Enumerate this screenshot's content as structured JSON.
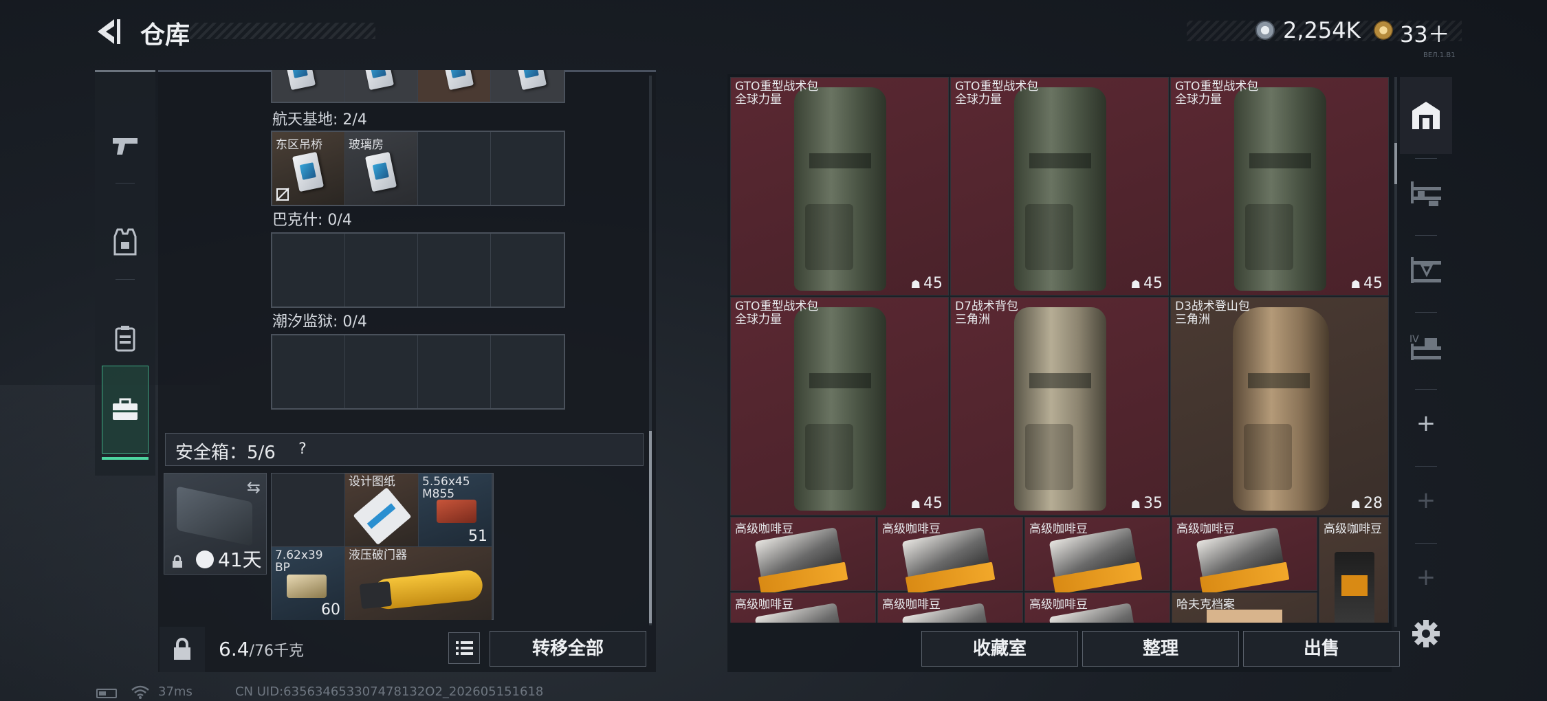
{
  "header": {
    "title": "仓库",
    "currency1": "2,254K",
    "currency2": "33＋",
    "version_tiny": "ВЕЛ.1.В1"
  },
  "left_nav": {
    "items": [
      {
        "icon": "pistol-icon"
      },
      {
        "icon": "armor-icon"
      },
      {
        "icon": "backpack-icon"
      },
      {
        "icon": "briefcase-icon",
        "active": true
      }
    ]
  },
  "storage": {
    "sections": [
      {
        "name": "航天基地: 2/4",
        "cells": [
          "东区吊桥",
          "玻璃房",
          "",
          ""
        ]
      },
      {
        "name": "巴克什: 0/4"
      },
      {
        "name": "潮汐监狱: 0/4"
      }
    ]
  },
  "safe_box": {
    "label": "安全箱：5/6",
    "help": "?",
    "days": "41天",
    "items": [
      {
        "label": ""
      },
      {
        "label": "设计图纸"
      },
      {
        "label": "5.56x45\nM855",
        "count": "51"
      },
      {
        "label": "7.62x39\nBP",
        "count": "60"
      },
      {
        "label": "液压破门器"
      }
    ]
  },
  "footer_left": {
    "weight": "6.4",
    "weight_max": "/76千克",
    "transfer_all": "转移全部"
  },
  "right_grid": {
    "big_items": [
      {
        "name": "GTO重型战术包",
        "sub": "全球力量",
        "count": "45",
        "style": "green",
        "bg": "red"
      },
      {
        "name": "GTO重型战术包",
        "sub": "全球力量",
        "count": "45",
        "style": "green",
        "bg": "red"
      },
      {
        "name": "GTO重型战术包",
        "sub": "全球力量",
        "count": "45",
        "style": "green",
        "bg": "red"
      },
      {
        "name": "GTO重型战术包",
        "sub": "全球力量",
        "count": "45",
        "style": "green",
        "bg": "red"
      },
      {
        "name": "D7战术背包",
        "sub": "三角洲",
        "count": "35",
        "style": "tan",
        "bg": "red"
      },
      {
        "name": "D3战术登山包",
        "sub": "三角洲",
        "count": "28",
        "style": "desert",
        "bg": "brown"
      }
    ],
    "small_items": [
      "高级咖啡豆",
      "高级咖啡豆",
      "高级咖啡豆",
      "高级咖啡豆",
      "高级咖啡豆",
      "高级咖啡豆",
      "高级咖啡豆",
      "哈夫克档案"
    ],
    "tall_item": "高级咖啡豆"
  },
  "footer_right": {
    "collection": "收藏室",
    "sort": "整理",
    "sell": "出售"
  },
  "right_nav": {
    "items": [
      "warehouse-icon",
      "rack-1-icon",
      "rack-2-icon",
      "rack-4-icon",
      "+",
      "+",
      "+"
    ]
  },
  "status_bar": {
    "ping": "37ms",
    "uid": "CN UID:635634653307478132O2_202605151618"
  }
}
